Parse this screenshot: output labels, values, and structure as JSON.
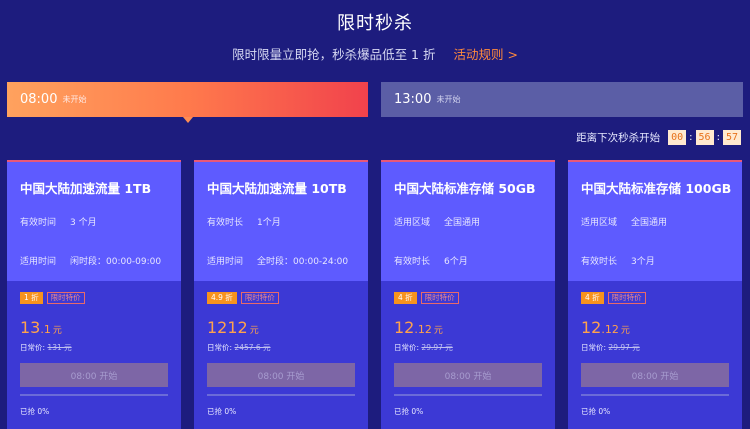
{
  "header": {
    "title": "限时秒杀",
    "subtitle": "限时限量立即抢，秒杀爆品低至 1 折",
    "rule_link": "活动规则 >"
  },
  "slots": [
    {
      "time": "08:00",
      "state": "未开始",
      "active": true
    },
    {
      "time": "13:00",
      "state": "未开始",
      "active": false
    }
  ],
  "countdown": {
    "label": "距离下次秒杀开始",
    "hours": "00",
    "minutes": "56",
    "seconds": "57",
    "sep": ":"
  },
  "cards": [
    {
      "name": "中国大陆加速流量 1TB",
      "row1": {
        "k": "有效时间",
        "v": "3 个月"
      },
      "row2": {
        "k": "适用时间",
        "v": "闲时段：00:00-09:00"
      },
      "discount": "1 折",
      "limit_tag": "限时特价",
      "price_int": "13",
      "price_dec": ".1",
      "yuan": "元",
      "orig_label": "日常价:",
      "orig_price": "131 元",
      "button": "08:00 开始",
      "progress": 0,
      "sold": "已抢 0%"
    },
    {
      "name": "中国大陆加速流量 10TB",
      "row1": {
        "k": "有效时长",
        "v": "1个月"
      },
      "row2": {
        "k": "适用时间",
        "v": "全时段：00:00-24:00"
      },
      "discount": "4.9 折",
      "limit_tag": "限时特价",
      "price_int": "1212",
      "price_dec": "",
      "yuan": "元",
      "orig_label": "日常价:",
      "orig_price": "2457.6 元",
      "button": "08:00 开始",
      "progress": 0,
      "sold": "已抢 0%"
    },
    {
      "name": "中国大陆标准存储 50GB",
      "row1": {
        "k": "适用区域",
        "v": "全国通用"
      },
      "row2": {
        "k": "有效时长",
        "v": "6个月"
      },
      "discount": "4 折",
      "limit_tag": "限时特价",
      "price_int": "12",
      "price_dec": ".12",
      "yuan": "元",
      "orig_label": "日常价:",
      "orig_price": "29.97 元",
      "button": "08:00 开始",
      "progress": 0,
      "sold": "已抢 0%"
    },
    {
      "name": "中国大陆标准存储 100GB",
      "row1": {
        "k": "适用区域",
        "v": "全国通用"
      },
      "row2": {
        "k": "有效时长",
        "v": "3个月"
      },
      "discount": "4 折",
      "limit_tag": "限时特价",
      "price_int": "12",
      "price_dec": ".12",
      "yuan": "元",
      "orig_label": "日常价:",
      "orig_price": "29.97 元",
      "button": "08:00 开始",
      "progress": 0,
      "sold": "已抢 0%"
    }
  ]
}
